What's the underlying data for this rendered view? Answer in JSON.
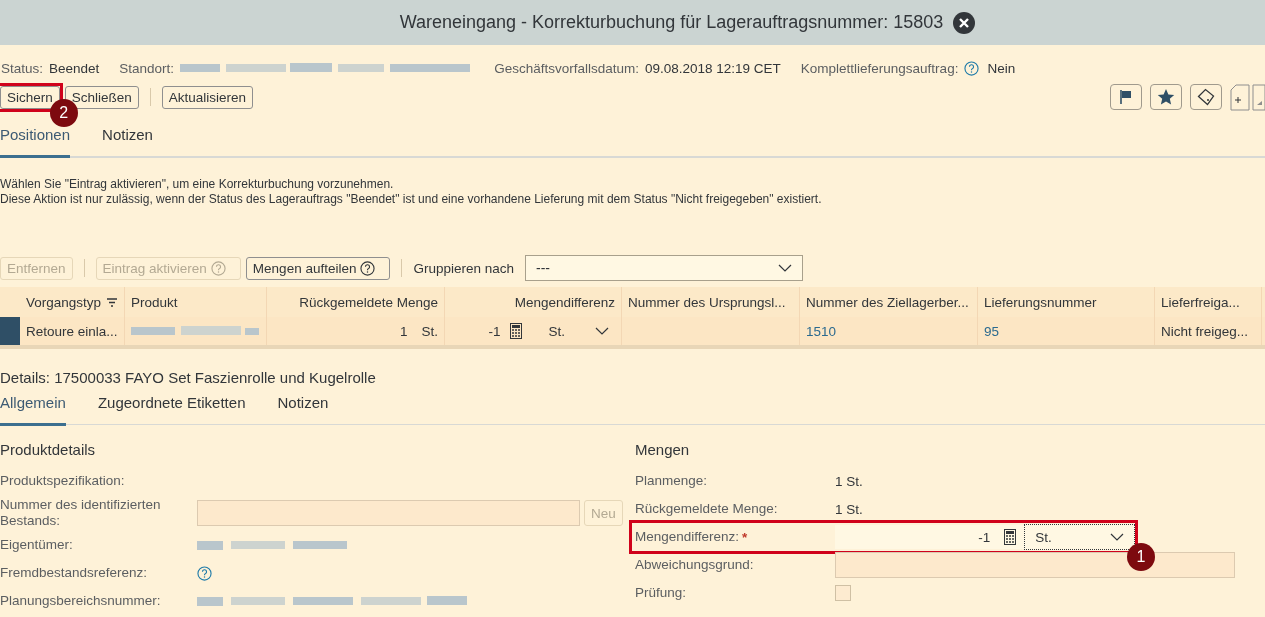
{
  "window": {
    "title": "Wareneingang - Korrekturbuchung für Lagerauftragsnummer: 15803"
  },
  "header_fields": [
    {
      "label": "Status:",
      "value": "Beendet",
      "kind": "text"
    },
    {
      "label": "Standort:",
      "kind": "redacted"
    },
    {
      "label": "Geschäftsvorfallsdatum:",
      "value": "09.08.2018 12:19 CET",
      "kind": "text"
    },
    {
      "label": "Komplettlieferungsauftrag:",
      "value": "Nein",
      "kind": "help"
    }
  ],
  "toolbar": [
    {
      "label": "Sichern",
      "callout": "2"
    },
    {
      "label": "Schließen"
    },
    {
      "label": "Aktualisieren",
      "separated": true
    }
  ],
  "tabs": [
    {
      "label": "Positionen",
      "selected": true
    },
    {
      "label": "Notizen",
      "selected": false
    }
  ],
  "message": [
    "Wählen Sie \"Eintrag aktivieren\", um eine Korrekturbuchung vorzunehmen.",
    "Diese Aktion ist nur zulässig, wenn der Status des Lagerauftrags \"Beendet\" ist und eine vorhandene Lieferung mit dem Status \"Nicht freigegeben\" existiert."
  ],
  "table_toolbar": {
    "buttons": [
      {
        "label": "Entfernen",
        "disabled": true,
        "help": false
      },
      {
        "label": "Eintrag aktivieren",
        "disabled": true,
        "help": true
      },
      {
        "label": "Mengen aufteilen",
        "disabled": false,
        "help": true
      }
    ],
    "group_label": "Gruppieren nach",
    "group_value": "---"
  },
  "table": {
    "columns": [
      {
        "label": "Vorgangstyp",
        "sort": true
      },
      {
        "label": "Produkt"
      },
      {
        "label": "Rückgemeldete Menge"
      },
      {
        "label": "Mengendifferenz"
      },
      {
        "label": "Nummer des Ursprungsl..."
      },
      {
        "label": "Nummer des Ziellagerber..."
      },
      {
        "label": "Lieferungsnummer"
      },
      {
        "label": "Lieferfreiga..."
      }
    ],
    "rows": [
      {
        "selected": true,
        "cells": [
          {
            "kind": "text",
            "value": "Retoure einla..."
          },
          {
            "kind": "redacted"
          },
          {
            "kind": "qty",
            "value": "1",
            "unit": "St."
          },
          {
            "kind": "qtyinput",
            "value": "-1",
            "unit": "St."
          },
          {
            "kind": "empty"
          },
          {
            "kind": "link",
            "value": "1510"
          },
          {
            "kind": "link",
            "value": "95"
          },
          {
            "kind": "text",
            "value": "Nicht freigeg..."
          }
        ]
      }
    ]
  },
  "details": {
    "title": "Details: 17500033 FAYO Set Faszienrolle und Kugelrolle",
    "tabs": [
      {
        "label": "Allgemein",
        "selected": true
      },
      {
        "label": "Zugeordnete Etiketten",
        "selected": false
      },
      {
        "label": "Notizen",
        "selected": false
      }
    ],
    "sections": [
      {
        "title": "Produktdetails",
        "fields": [
          {
            "label": "Produktspezifikation:",
            "kind": "empty"
          },
          {
            "label": "Nummer des identifizierten Bestands:",
            "kind": "inputbutton",
            "button": "Neu"
          },
          {
            "label": "Eigentümer:",
            "kind": "redacted"
          },
          {
            "label": "Fremdbestandsreferenz:",
            "kind": "help"
          },
          {
            "label": "Planungsbereichsnummer:",
            "kind": "redacted"
          }
        ]
      },
      {
        "title": "Mengen",
        "fields": [
          {
            "label": "Planmenge:",
            "kind": "text",
            "value": "1 St."
          },
          {
            "label": "Rückgemeldete Menge:",
            "kind": "text",
            "value": "1 St."
          },
          {
            "label": "Mengendifferenz:",
            "kind": "quantity",
            "required_mark": "*",
            "value": "-1",
            "unit": "St.",
            "callout": "1"
          },
          {
            "label": "Abweichungsgrund:",
            "kind": "input"
          },
          {
            "label": "Prüfung:",
            "kind": "checkbox",
            "checked": false
          }
        ]
      }
    ]
  }
}
